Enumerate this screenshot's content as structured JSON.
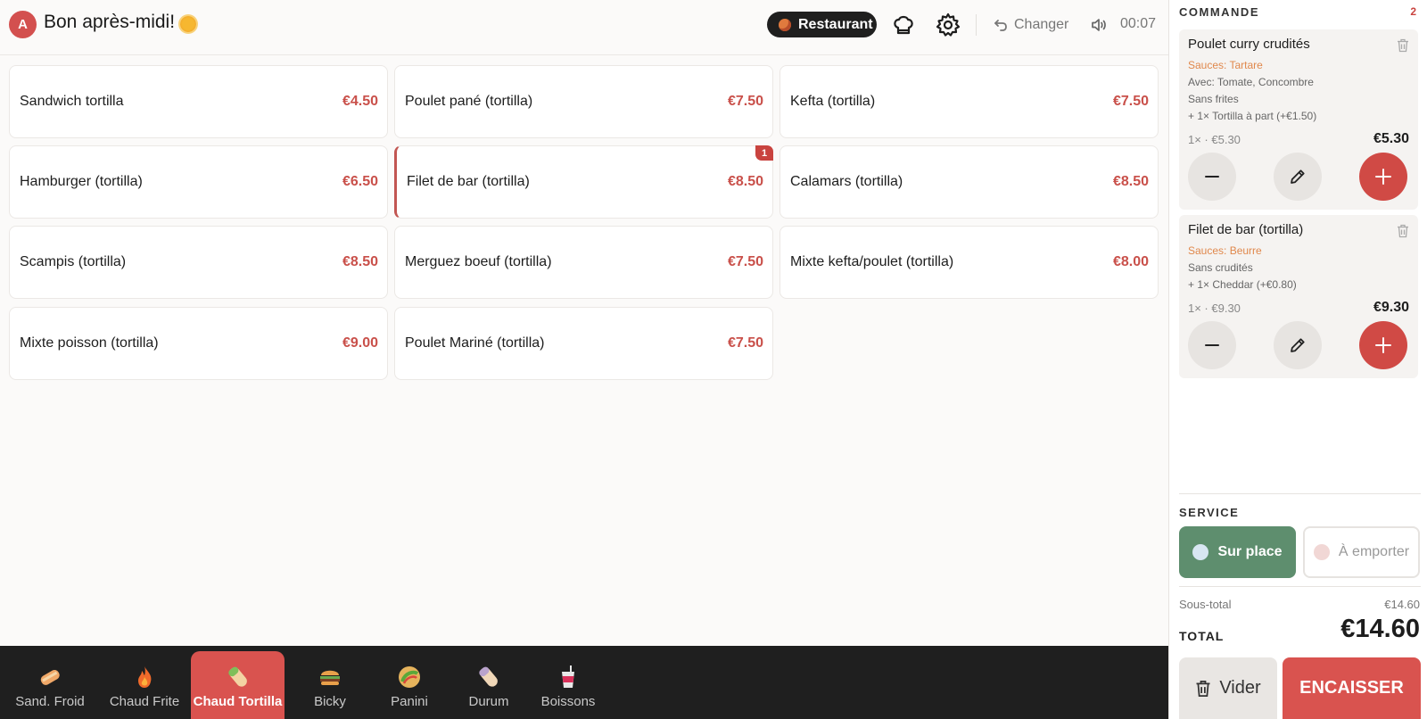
{
  "header": {
    "avatar_letter": "A",
    "greeting": "Bon après-midi!",
    "mode_label": "Restaurant",
    "change_label": "Changer",
    "clock": "00:07"
  },
  "products": [
    {
      "name": "Sandwich tortilla",
      "price": "€4.50"
    },
    {
      "name": "Poulet pané (tortilla)",
      "price": "€7.50"
    },
    {
      "name": "Kefta (tortilla)",
      "price": "€7.50"
    },
    {
      "name": "Hamburger (tortilla)",
      "price": "€6.50"
    },
    {
      "name": "Filet de bar (tortilla)",
      "price": "€8.50",
      "badge": "1"
    },
    {
      "name": "Calamars (tortilla)",
      "price": "€8.50"
    },
    {
      "name": "Scampis (tortilla)",
      "price": "€8.50"
    },
    {
      "name": "Merguez boeuf (tortilla)",
      "price": "€7.50"
    },
    {
      "name": "Mixte kefta/poulet (tortilla)",
      "price": "€8.00"
    },
    {
      "name": "Mixte poisson (tortilla)",
      "price": "€9.00"
    },
    {
      "name": "Poulet Mariné (tortilla)",
      "price": "€7.50"
    }
  ],
  "categories": [
    {
      "label": "Sand. Froid",
      "icon": "sandwich-icon"
    },
    {
      "label": "Chaud Frite",
      "icon": "flame-icon"
    },
    {
      "label": "Chaud Tortilla",
      "icon": "wrap-icon",
      "active": true
    },
    {
      "label": "Bicky",
      "icon": "burger-icon"
    },
    {
      "label": "Panini",
      "icon": "taco-icon"
    },
    {
      "label": "Durum",
      "icon": "durum-icon"
    },
    {
      "label": "Boissons",
      "icon": "drink-icon"
    }
  ],
  "order": {
    "title": "COMMANDE",
    "count": "2",
    "items": [
      {
        "name": "Poulet curry crudités",
        "sauces": "Sauces: Tartare",
        "details": [
          "Avec: Tomate, Concombre",
          "Sans frites",
          "+ 1× Tortilla à part (+€1.50)"
        ],
        "qty_line": "1× · €5.30",
        "total": "€5.30"
      },
      {
        "name": "Filet de bar (tortilla)",
        "sauces": "Sauces: Beurre",
        "details": [
          "Sans crudités",
          "+ 1× Cheddar (+€0.80)"
        ],
        "qty_line": "1× · €9.30",
        "total": "€9.30"
      }
    ]
  },
  "service": {
    "title": "SERVICE",
    "dine_in": "Sur place",
    "takeaway": "À emporter"
  },
  "totals": {
    "subtotal_label": "Sous-total",
    "subtotal_value": "€14.60",
    "total_label": "TOTAL",
    "total_value": "€14.60"
  },
  "actions": {
    "clear_label": "Vider",
    "pay_label": "ENCAISSER"
  },
  "colors": {
    "accent": "#d9534f",
    "dine_in": "#5e8e6e",
    "nav_bg": "#1f1f1f"
  }
}
